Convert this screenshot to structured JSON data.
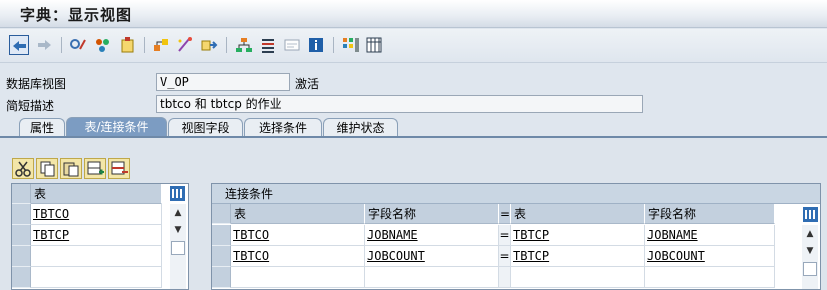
{
  "window": {
    "title": "字典：显示视图"
  },
  "toolbar": {
    "icons": [
      "back-arrow",
      "forward-arrow",
      "display-change",
      "other-object",
      "activate",
      "where-used-list",
      "display-object-list",
      "navigate",
      "hierarchy",
      "stack",
      "fields-list",
      "info",
      "layout",
      "table-settings"
    ]
  },
  "header": {
    "view_label": "数据库视图",
    "view_value": "V_OP",
    "status": "激活",
    "desc_label": "简短描述",
    "desc_value": "tbtco 和 tbtcp 的作业"
  },
  "tabs": [
    {
      "label": "属性",
      "active": false
    },
    {
      "label": "表/连接条件",
      "active": true
    },
    {
      "label": "视图字段",
      "active": false
    },
    {
      "label": "选择条件",
      "active": false
    },
    {
      "label": "维护状态",
      "active": false
    }
  ],
  "small_toolbar": {
    "icons": [
      "cut",
      "copy",
      "paste",
      "insert-row",
      "delete-row"
    ]
  },
  "tables_grid": {
    "header": "表",
    "rows": [
      "TBTCO",
      "TBTCP",
      "",
      "",
      ""
    ]
  },
  "join_grid": {
    "title": "连接条件",
    "headers": {
      "table": "表",
      "field": "字段名称",
      "eq": "=",
      "table2": "表",
      "field2": "字段名称"
    },
    "rows": [
      {
        "t1": "TBTCO",
        "f1": "JOBNAME",
        "eq": "=",
        "t2": "TBTCP",
        "f2": "JOBNAME"
      },
      {
        "t1": "TBTCO",
        "f1": "JOBCOUNT",
        "eq": "=",
        "t2": "TBTCP",
        "f2": "JOBCOUNT"
      }
    ]
  }
}
